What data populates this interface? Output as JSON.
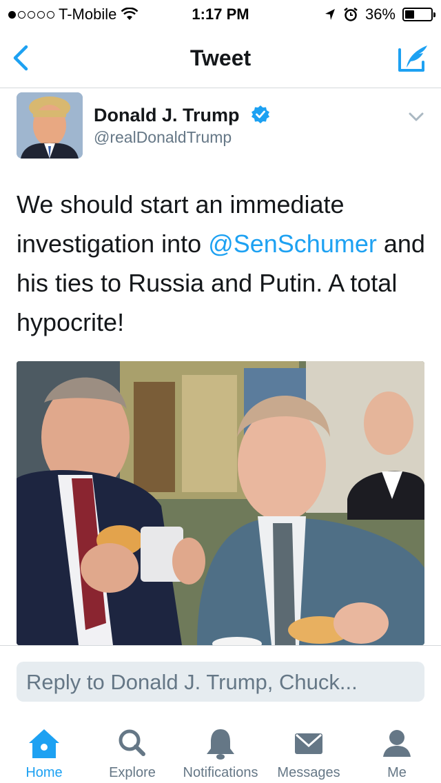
{
  "status_bar": {
    "carrier": "T-Mobile",
    "time": "1:17 PM",
    "battery": "36%",
    "signal_icon": "signal-dots-icon",
    "wifi_icon": "wifi-icon",
    "location_icon": "location-arrow-icon",
    "alarm_icon": "alarm-icon",
    "battery_level": 0.36
  },
  "nav": {
    "title": "Tweet",
    "back_icon": "back-chevron-icon",
    "compose_icon": "compose-tweet-icon"
  },
  "tweet": {
    "author_name": "Donald J. Trump",
    "author_handle": "@realDonaldTrump",
    "verified": true,
    "text_part1": "We should start an immediate investigation into ",
    "mention": "@SenSchumer",
    "text_part2": " and his ties to Russia and Putin. A total hypocrite!"
  },
  "reply": {
    "placeholder": "Reply to Donald J. Trump, Chuck..."
  },
  "tabs": [
    {
      "label": "Home",
      "icon": "home-icon",
      "active": true
    },
    {
      "label": "Explore",
      "icon": "search-icon",
      "active": false
    },
    {
      "label": "Notifications",
      "icon": "bell-icon",
      "active": false
    },
    {
      "label": "Messages",
      "icon": "envelope-icon",
      "active": false
    },
    {
      "label": "Me",
      "icon": "person-icon",
      "active": false
    }
  ],
  "colors": {
    "accent": "#1da1f2",
    "text": "#14171a",
    "secondary": "#657786",
    "reply_bg": "#e6ecf0"
  }
}
